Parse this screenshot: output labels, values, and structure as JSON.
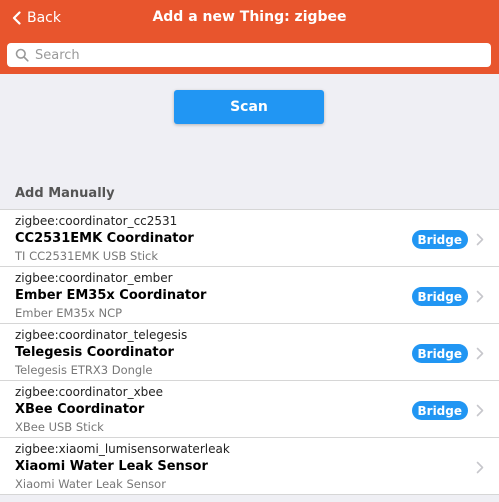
{
  "navbar": {
    "back_label": "Back",
    "title": "Add a new Thing: zigbee"
  },
  "search": {
    "placeholder": "Search"
  },
  "scan_button": {
    "label": "Scan"
  },
  "section": {
    "title": "Add Manually"
  },
  "things": [
    {
      "uid": "zigbee:coordinator_cc2531",
      "label": "CC2531EMK Coordinator",
      "description": "TI CC2531EMK USB Stick",
      "badge": "Bridge"
    },
    {
      "uid": "zigbee:coordinator_ember",
      "label": "Ember EM35x Coordinator",
      "description": "Ember EM35x NCP",
      "badge": "Bridge"
    },
    {
      "uid": "zigbee:coordinator_telegesis",
      "label": "Telegesis Coordinator",
      "description": "Telegesis ETRX3 Dongle",
      "badge": "Bridge"
    },
    {
      "uid": "zigbee:coordinator_xbee",
      "label": "XBee Coordinator",
      "description": "XBee USB Stick",
      "badge": "Bridge"
    },
    {
      "uid": "zigbee:xiaomi_lumisensorwaterleak",
      "label": "Xiaomi Water Leak Sensor",
      "description": "Xiaomi Water Leak Sensor",
      "badge": ""
    }
  ],
  "colors": {
    "navbar": "#e8552d",
    "accent": "#2196f3",
    "background": "#efeff4"
  },
  "icons": {
    "back": "chevron-left-icon",
    "search": "search-icon",
    "row": "chevron-right-icon"
  }
}
